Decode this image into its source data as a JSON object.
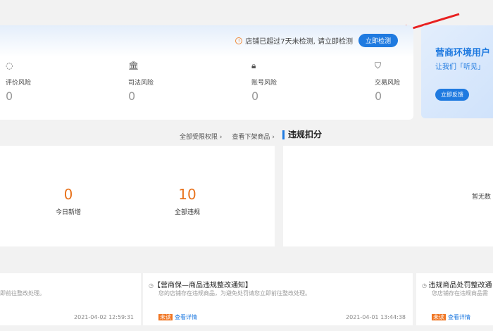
{
  "risk": {
    "alert": "店铺已超过7天未检测, 请立即检测",
    "detect_button": "立即检测",
    "items": [
      {
        "icon": "comment-icon",
        "label": "评价风险",
        "value": "0"
      },
      {
        "icon": "bank-icon",
        "label": "司法风险",
        "value": "0"
      },
      {
        "icon": "lock-icon",
        "label": "账号风险",
        "value": "0"
      },
      {
        "icon": "shield-icon",
        "label": "交易风险",
        "value": "0"
      }
    ]
  },
  "banner": {
    "title": "营商环境用户",
    "subtitle": "让我们「听见」",
    "button": "立即反馈"
  },
  "links": {
    "all": "全部受限权限 ›",
    "offshelf": "查看下架商品 ›"
  },
  "violation": {
    "title": "违规扣分",
    "empty": "暂无数"
  },
  "stats": [
    {
      "value": "0",
      "label": "今日新增"
    },
    {
      "value": "10",
      "label": "全部违规"
    }
  ],
  "notices": [
    {
      "title": "",
      "desc": "即前往整改处理。",
      "time": "2021-04-02 12:59:31"
    },
    {
      "title": "【营商保—商品违规整改通知】",
      "desc": "您的店铺存在违规商品，为避免处罚请您立即前往整改处理。",
      "time": "2021-04-01 13:44:38",
      "badge": "未读",
      "link": "查看详情"
    },
    {
      "title": "违规商品处罚整改通",
      "desc": "您店铺存在违规商品需",
      "badge": "未读",
      "link": "查看详情"
    }
  ],
  "colors": {
    "accent": "#1f7ae0",
    "orange": "#e8731d"
  }
}
